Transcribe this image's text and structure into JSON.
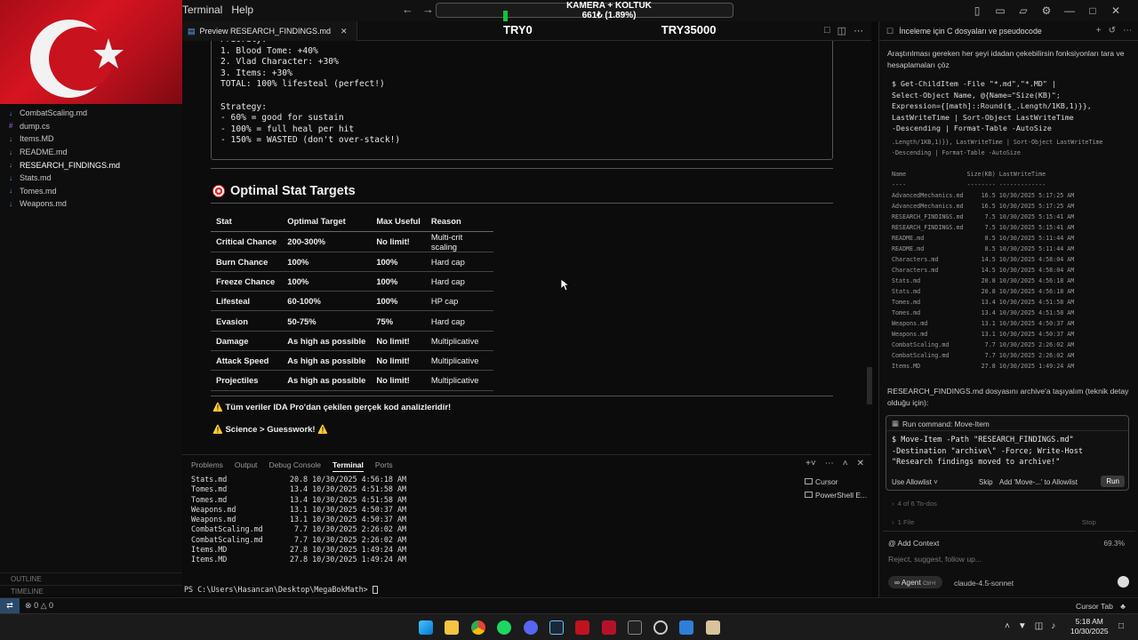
{
  "titlebar": {
    "menu": [
      "Terminal",
      "Help"
    ],
    "overlay_title": "KAMERA + KOLTUK",
    "overlay_amount": "661₺ (1.89%)",
    "ticker": [
      "TRY0",
      "TRY35000"
    ]
  },
  "sidebar": {
    "files": [
      {
        "name": "CombatScaling.md",
        "icon": "markdown-icon"
      },
      {
        "name": "dump.cs",
        "icon": "csharp-icon"
      },
      {
        "name": "Items.MD",
        "icon": "markdown-icon"
      },
      {
        "name": "README.md",
        "icon": "markdown-icon"
      },
      {
        "name": "RESEARCH_FINDINGS.md",
        "icon": "markdown-icon",
        "active": true
      },
      {
        "name": "Stats.md",
        "icon": "markdown-icon"
      },
      {
        "name": "Tomes.md",
        "icon": "markdown-icon"
      },
      {
        "name": "Weapons.md",
        "icon": "markdown-icon"
      }
    ],
    "outline": "OUTLINE",
    "timeline": "TIMELINE"
  },
  "statusbar": {
    "problems": "0",
    "warnings": "0"
  },
  "editor": {
    "tab_label": "Preview RESEARCH_FINDINGS.md",
    "code_lines": [
      "Priority:",
      "1. Blood Tome: +40%",
      "2. Vlad Character: +30%",
      "3. Items: +30%",
      "TOTAL: 100% lifesteal (perfect!)",
      "",
      "Strategy:",
      "- 60% = good for sustain",
      "- 100% = full heal per hit",
      "- 150% = WASTED (don't over-stack!)"
    ],
    "section_title": "Optimal Stat Targets",
    "table": {
      "headers": [
        "Stat",
        "Optimal Target",
        "Max Useful",
        "Reason"
      ],
      "rows": [
        [
          "Critical Chance",
          "200-300%",
          "No limit!",
          "Multi-crit scaling"
        ],
        [
          "Burn Chance",
          "100%",
          "100%",
          "Hard cap"
        ],
        [
          "Freeze Chance",
          "100%",
          "100%",
          "Hard cap"
        ],
        [
          "Lifesteal",
          "60-100%",
          "100%",
          "HP cap"
        ],
        [
          "Evasion",
          "50-75%",
          "75%",
          "Hard cap"
        ],
        [
          "Damage",
          "As high as possible",
          "No limit!",
          "Multiplicative"
        ],
        [
          "Attack Speed",
          "As high as possible",
          "No limit!",
          "Multiplicative"
        ],
        [
          "Projectiles",
          "As high as possible",
          "No limit!",
          "Multiplicative"
        ]
      ]
    },
    "note1": "⚠️ Tüm veriler IDA Pro'dan çekilen gerçek kod analizleridir!",
    "note2": "⚠️ Science > Guesswork! ⚠️"
  },
  "panel": {
    "tabs": [
      "Problems",
      "Output",
      "Debug Console",
      "Terminal",
      "Ports"
    ],
    "active_tab": "Terminal",
    "terminal_lines": [
      "Stats.md              20.8 10/30/2025 4:56:18 AM",
      "Tomes.md              13.4 10/30/2025 4:51:58 AM",
      "Tomes.md              13.4 10/30/2025 4:51:58 AM",
      "Weapons.md            13.1 10/30/2025 4:50:37 AM",
      "Weapons.md            13.1 10/30/2025 4:50:37 AM",
      "CombatScaling.md       7.7 10/30/2025 2:26:02 AM",
      "CombatScaling.md       7.7 10/30/2025 2:26:02 AM",
      "Items.MD              27.8 10/30/2025 1:49:24 AM",
      "Items.MD              27.8 10/30/2025 1:49:24 AM"
    ],
    "prompt": "PS C:\\Users\\Hasancan\\Desktop\\MegaBokMath> ",
    "terminals": [
      "Cursor",
      "PowerShell E..."
    ]
  },
  "chat": {
    "header_title": "İnceleme için C dosyaları ve pseudocode",
    "message1": "Araştırılması gereken her şeyi idadan çekebilirsin fonksiyonları tara ve hesaplamaları çöz",
    "command_code": "$ Get-ChildItem -File \"*.md\",\"*.MD\" |\nSelect-Object Name, @{Name=\"Size(KB)\";\nExpression={[math]::Round($_.Length/1KB,1)}},\nLastWriteTime | Sort-Object LastWriteTime\n-Descending | Format-Table -AutoSize",
    "command_output": ".Length/1KB,1)}}, LastWriteTime | Sort-Object LastWriteTime\n-Descending | Format-Table -AutoSize\n\nName                 Size(KB) LastWriteTime\n----                 -------- -------------\nAdvancedMechanics.md     16.5 10/30/2025 5:17:25 AM\nAdvancedMechanics.md     16.5 10/30/2025 5:17:25 AM\nRESEARCH_FINDINGS.md      7.5 10/30/2025 5:15:41 AM\nRESEARCH_FINDINGS.md      7.5 10/30/2025 5:15:41 AM\nREADME.md                 8.5 10/30/2025 5:11:44 AM\nREADME.md                 8.5 10/30/2025 5:11:44 AM\nCharacters.md            14.5 10/30/2025 4:58:04 AM\nCharacters.md            14.5 10/30/2025 4:58:04 AM\nStats.md                 20.8 10/30/2025 4:56:18 AM\nStats.md                 20.8 10/30/2025 4:56:18 AM\nTomes.md                 13.4 10/30/2025 4:51:58 AM\nTomes.md                 13.4 10/30/2025 4:51:58 AM\nWeapons.md               13.1 10/30/2025 4:50:37 AM\nWeapons.md               13.1 10/30/2025 4:50:37 AM\nCombatScaling.md          7.7 10/30/2025 2:26:02 AM\nCombatScaling.md          7.7 10/30/2025 2:26:02 AM\nItems.MD                 27.8 10/30/2025 1:49:24 AM",
    "message2": "RESEARCH_FINDINGS.md dosyasını archive'a taşıyalım (teknik detay olduğu için):",
    "run_card_title": "Run command: Move-Item",
    "run_command": "$ Move-Item -Path \"RESEARCH_FINDINGS.md\"\n-Destination \"archive\\\" -Force; Write-Host\n\"Research findings moved to archive!\"",
    "allowlist": "Use Allowlist",
    "skip": "Skip",
    "add_allowlist": "Add 'Move-...' to Allowlist",
    "run": "Run",
    "todos": "4 of 6 To-dos",
    "files": "1 File",
    "stop": "Stop",
    "add_context": "@ Add Context",
    "context_pct": "69.3%",
    "input_placeholder": "Reject, suggest, follow up...",
    "agent": "Agent",
    "agent_shortcut": "Ctrl+I",
    "model": "claude-4.5-sonnet",
    "cursor_tab": "Cursor Tab"
  },
  "taskbar": {
    "time": "5:18 AM",
    "date": "10/30/2025"
  }
}
